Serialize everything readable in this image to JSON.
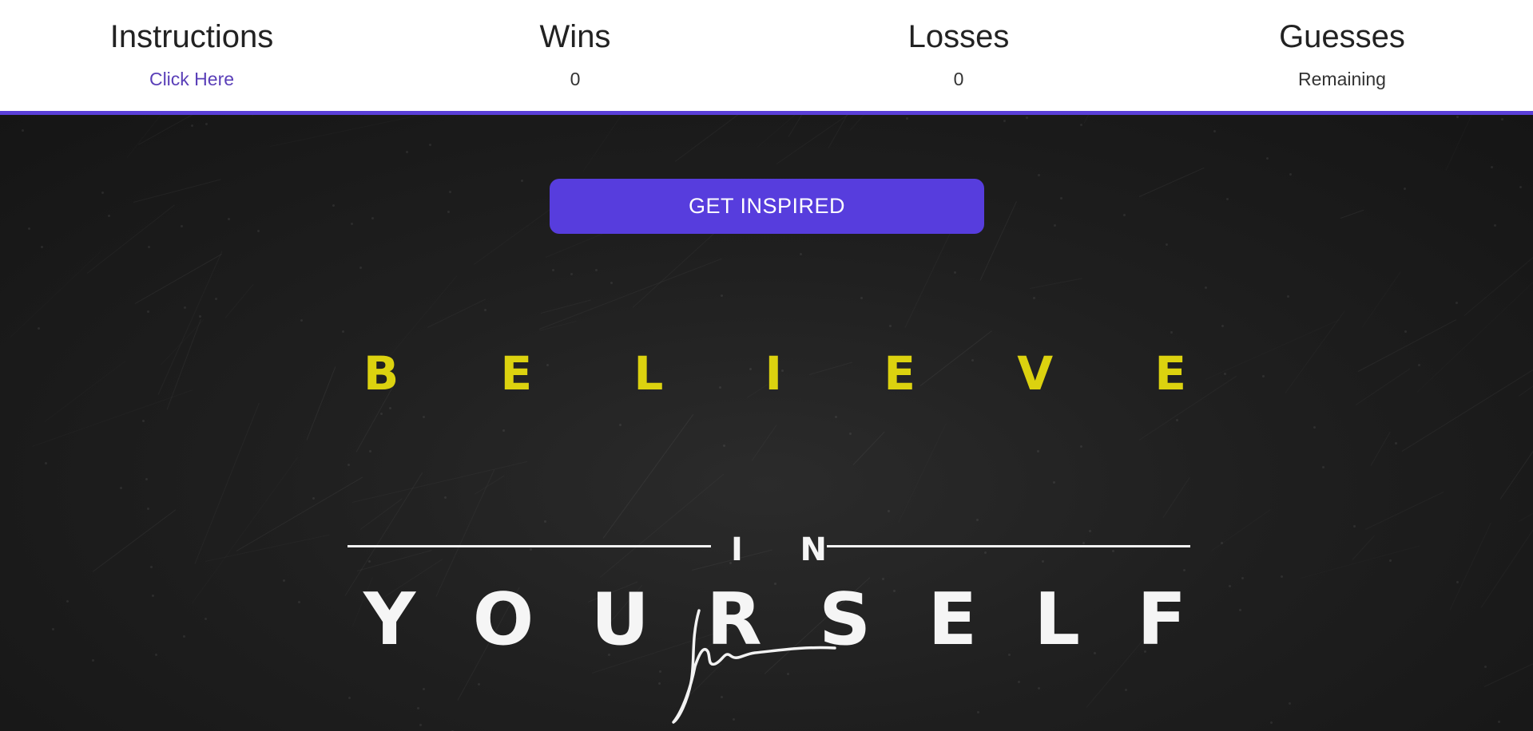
{
  "stats": {
    "instructions": {
      "title": "Instructions",
      "link": "Click Here"
    },
    "wins": {
      "title": "Wins",
      "value": "0"
    },
    "losses": {
      "title": "Losses",
      "value": "0"
    },
    "guesses": {
      "title": "Guesses",
      "value": "Remaining"
    }
  },
  "hero": {
    "button_label": "GET INSPIRED",
    "poster": {
      "line1": [
        "B",
        "E",
        "L",
        "I",
        "E",
        "V",
        "E"
      ],
      "line2": [
        "I",
        "N"
      ],
      "line3": [
        "Y",
        "O",
        "U",
        "R",
        "S",
        "E",
        "L",
        "F"
      ]
    }
  },
  "colors": {
    "accent": "#573ddd",
    "border": "#5a3fd8",
    "believe_yellow": "#dcd20f"
  }
}
